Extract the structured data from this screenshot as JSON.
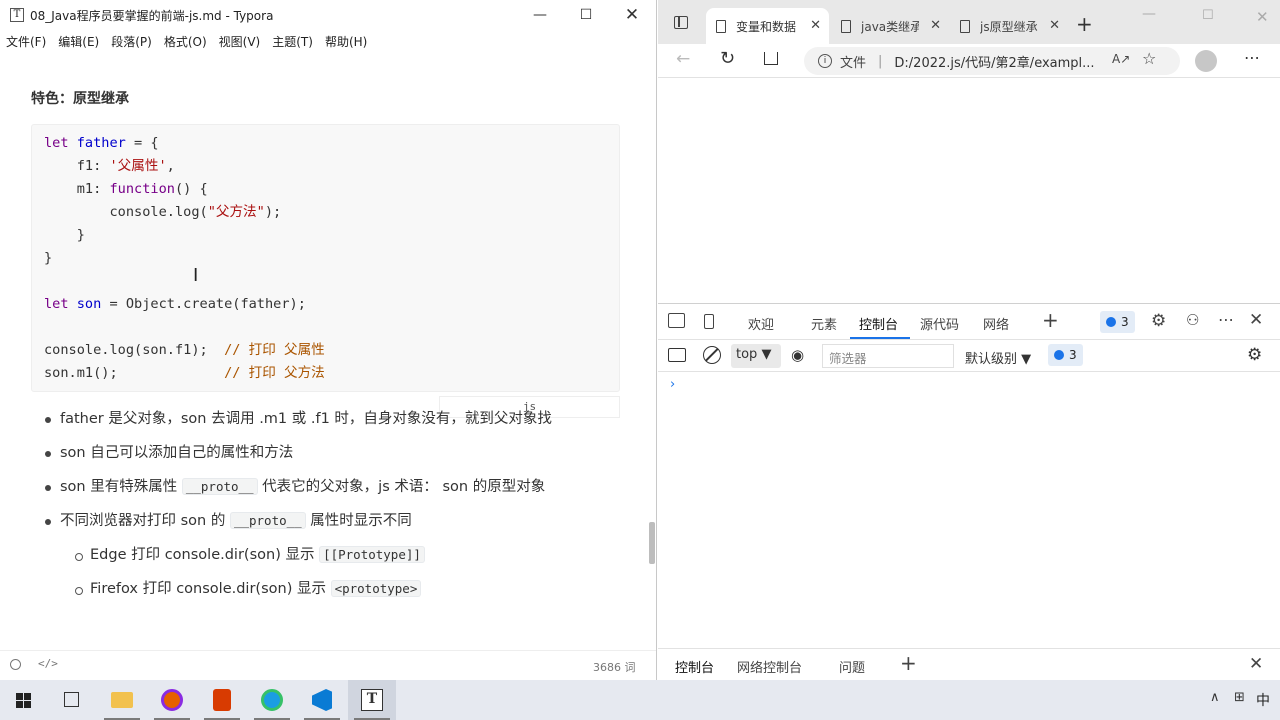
{
  "typora": {
    "title": "08_Java程序员要掌握的前端-js.md - Typora",
    "menu": [
      "文件(F)",
      "编辑(E)",
      "段落(P)",
      "格式(O)",
      "视图(V)",
      "主题(T)",
      "帮助(H)"
    ],
    "heading": "特色：原型继承",
    "code_lang": "js",
    "bullets": [
      {
        "parts": [
          "father 是父对象，son 去调用 .m1 或 .f1 时，自身对象没有，就到父对象找"
        ]
      },
      {
        "parts": [
          "son 自己可以添加自己的属性和方法"
        ]
      },
      {
        "pre": "son 里有特殊属性 ",
        "code": "__proto__",
        "post": " 代表它的父对象，js 术语： son 的原型对象"
      },
      {
        "pre": "不同浏览器对打印 son 的 ",
        "code": "__proto__",
        "post": " 属性时显示不同"
      }
    ],
    "sub_bullets": [
      {
        "pre": "Edge 打印 console.dir(son) 显示 ",
        "code": "[[Prototype]]"
      },
      {
        "pre": "Firefox 打印 console.dir(son) 显示 ",
        "code": "<prototype>"
      }
    ],
    "word_count": "3686 词"
  },
  "edge": {
    "tabs": [
      "变量和数据",
      "java类继承",
      "js原型继承"
    ],
    "address_label": "文件",
    "address_url": "D:/2022.js/代码/第2章/exampl...",
    "devtools": {
      "tabs": [
        "欢迎",
        "元素",
        "控制台",
        "源代码",
        "网络"
      ],
      "issue_count": "3",
      "context": "top",
      "filter_placeholder": "筛选器",
      "level": "默认级别",
      "toolbar_issue_count": "3",
      "drawer_tabs": [
        "控制台",
        "网络控制台",
        "问题"
      ]
    }
  },
  "taskbar": {
    "tray_ime": "中"
  },
  "colors": {
    "keyword": "#770088",
    "variable": "#0000cc",
    "string": "#aa1111",
    "comment": "#aa5500",
    "accent": "#1a73e8"
  }
}
